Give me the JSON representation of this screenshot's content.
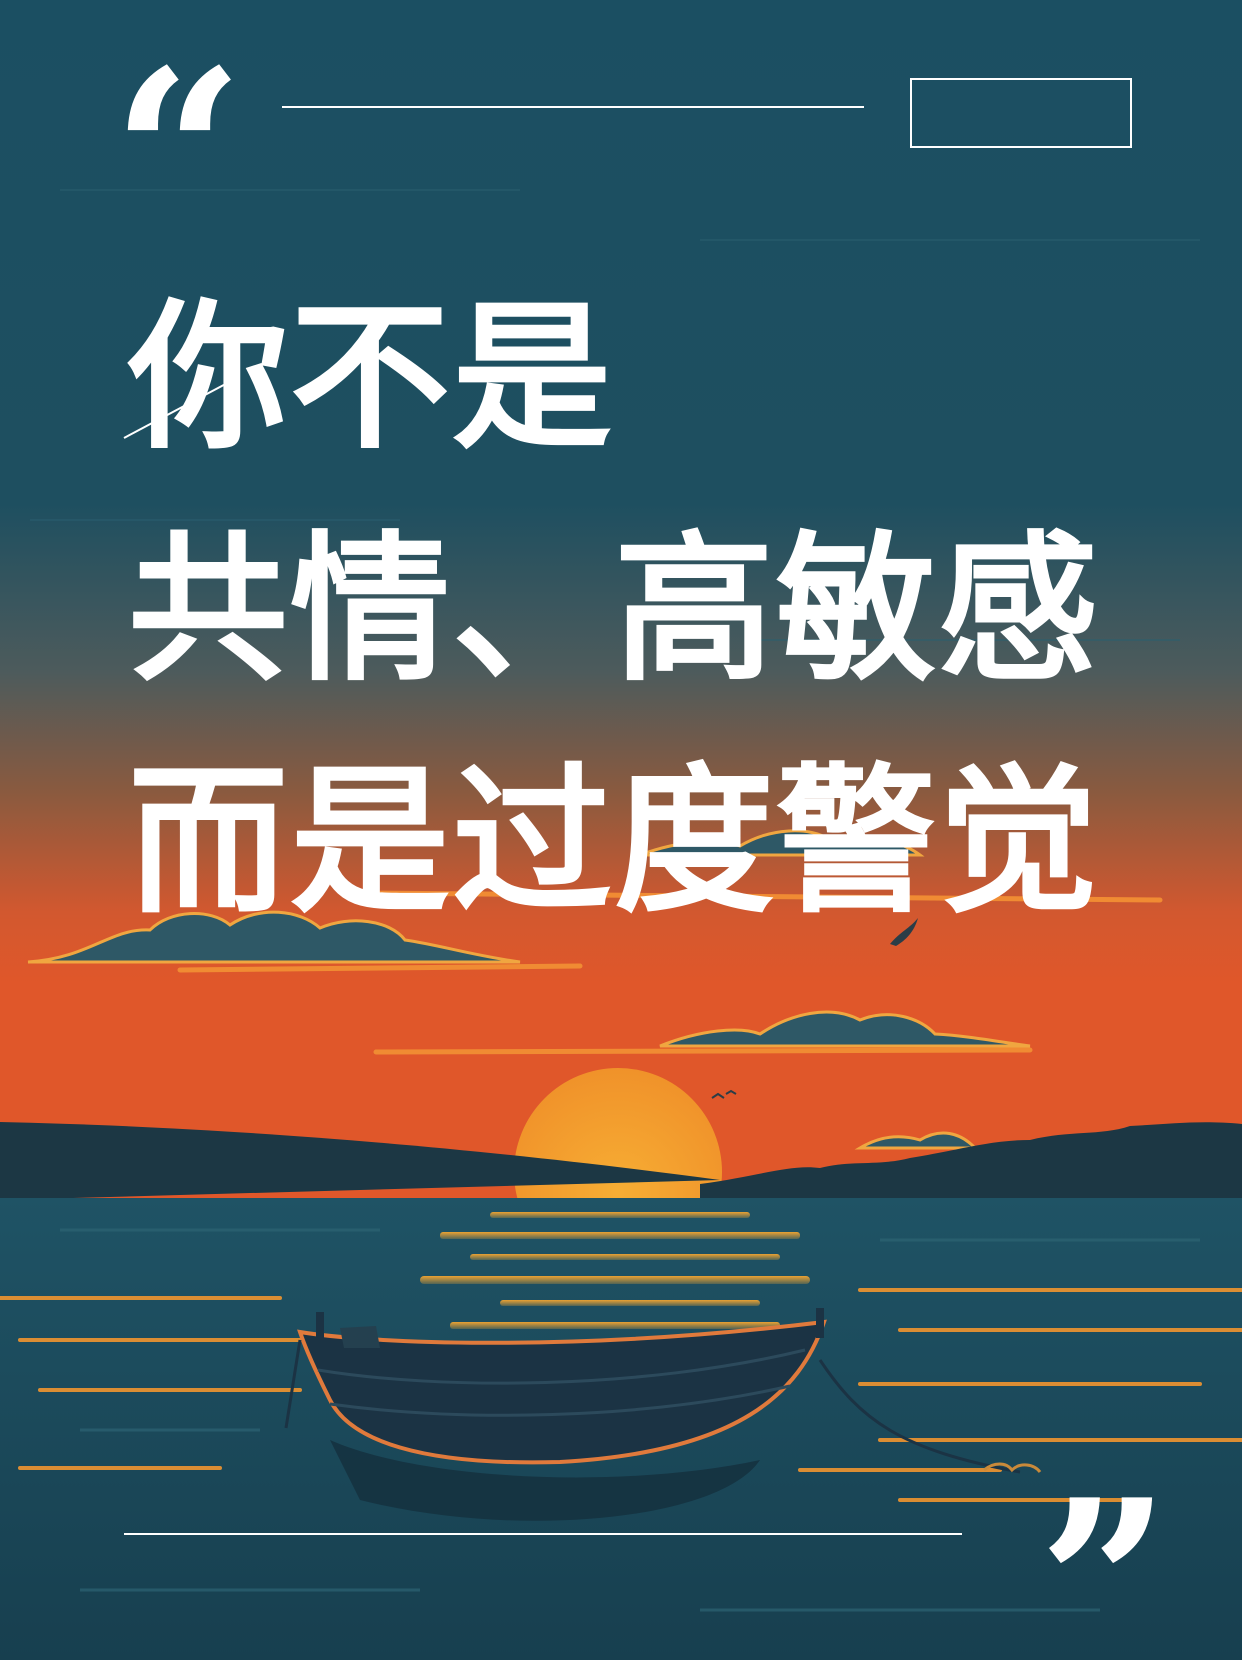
{
  "headline": {
    "line1": "你不是",
    "line2": "共情、高敏感",
    "line3": "而是过度警觉"
  },
  "decor": {
    "open_quote": "“",
    "close_quote": "”"
  },
  "colors": {
    "sky_top": "#1c4f62",
    "sky_mid": "#4a5a5e",
    "sunset_orange": "#d9582e",
    "sun": "#f5a630",
    "water": "#1c4a5a",
    "text": "#ffffff"
  },
  "icons": [
    "open-quote-icon",
    "close-quote-icon",
    "sun-icon",
    "boat-icon",
    "cloud-icon",
    "bird-icon"
  ]
}
